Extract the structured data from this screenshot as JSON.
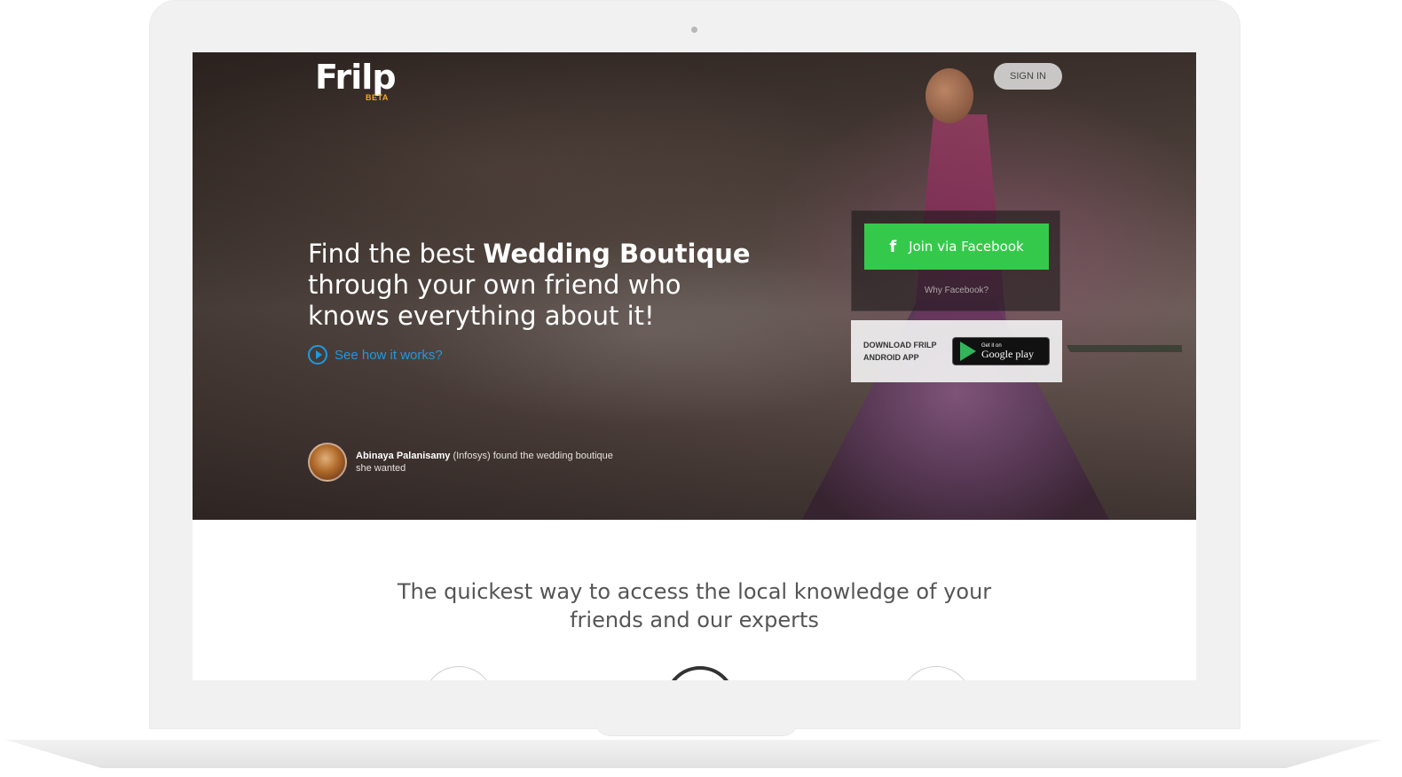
{
  "brand": {
    "logo_text": "Frilp",
    "badge": "BETA"
  },
  "header": {
    "signin_label": "SIGN IN"
  },
  "hero": {
    "headline_prefix": "Find the best ",
    "headline_bold": "Wedding Boutique",
    "headline_rest": " through your own friend who knows everything about it!",
    "see_how_label": "See how it works?"
  },
  "testimonial": {
    "name": "Abinaya Palanisamy",
    "company": "(Infosys)",
    "text": " found the wedding boutique she wanted"
  },
  "signup": {
    "facebook_icon": "f",
    "facebook_label": "Join via Facebook",
    "why_label": "Why Facebook?"
  },
  "app": {
    "download_text": "DOWNLOAD FRILP ANDROID APP",
    "store_small": "Get it on",
    "store_big": "Google play"
  },
  "section": {
    "tagline_line1": "The quickest way to access the local knowledge of your",
    "tagline_line2": "friends and our experts"
  },
  "colors": {
    "facebook_green": "#35c94b",
    "link_blue": "#1e9ae0",
    "beta_orange": "#f5a623"
  },
  "icons": [
    "play-circle-icon",
    "facebook-icon",
    "google-play-icon",
    "camera-dot-icon"
  ]
}
